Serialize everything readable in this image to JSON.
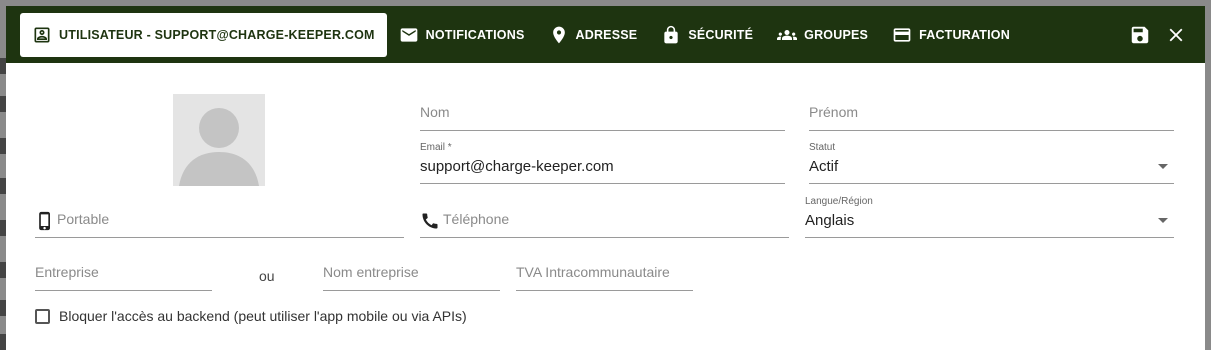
{
  "tabs": [
    {
      "label": "UTILISATEUR - SUPPORT@CHARGE-KEEPER.COM",
      "icon": "contact-card-icon",
      "active": true
    },
    {
      "label": "NOTIFICATIONS",
      "icon": "mail-icon"
    },
    {
      "label": "ADRESSE",
      "icon": "location-pin-icon"
    },
    {
      "label": "SÉCURITÉ",
      "icon": "lock-icon"
    },
    {
      "label": "GROUPES",
      "icon": "group-icon"
    },
    {
      "label": "FACTURATION",
      "icon": "credit-card-icon"
    }
  ],
  "actions": {
    "save_icon": "save-icon",
    "close_icon": "close-icon"
  },
  "form": {
    "nom": {
      "label": "Nom",
      "value": ""
    },
    "prenom": {
      "label": "Prénom",
      "value": ""
    },
    "email": {
      "label": "Email *",
      "value": "support@charge-keeper.com"
    },
    "statut": {
      "label": "Statut",
      "value": "Actif"
    },
    "portable": {
      "label": "Portable",
      "value": ""
    },
    "telephone": {
      "label": "Téléphone",
      "value": ""
    },
    "langue": {
      "label": "Langue/Région",
      "value": "Anglais"
    },
    "entreprise": {
      "label": "Entreprise",
      "value": ""
    },
    "ou": "ou",
    "nom_entreprise": {
      "label": "Nom entreprise",
      "value": ""
    },
    "tva": {
      "label": "TVA Intracommunautaire",
      "value": ""
    },
    "bloquer": {
      "label": "Bloquer l'accès au backend (peut utiliser l'app mobile ou via APIs)",
      "checked": false
    }
  },
  "colors": {
    "header": "#1e3410",
    "active_tab_bg": "#ffffff"
  }
}
